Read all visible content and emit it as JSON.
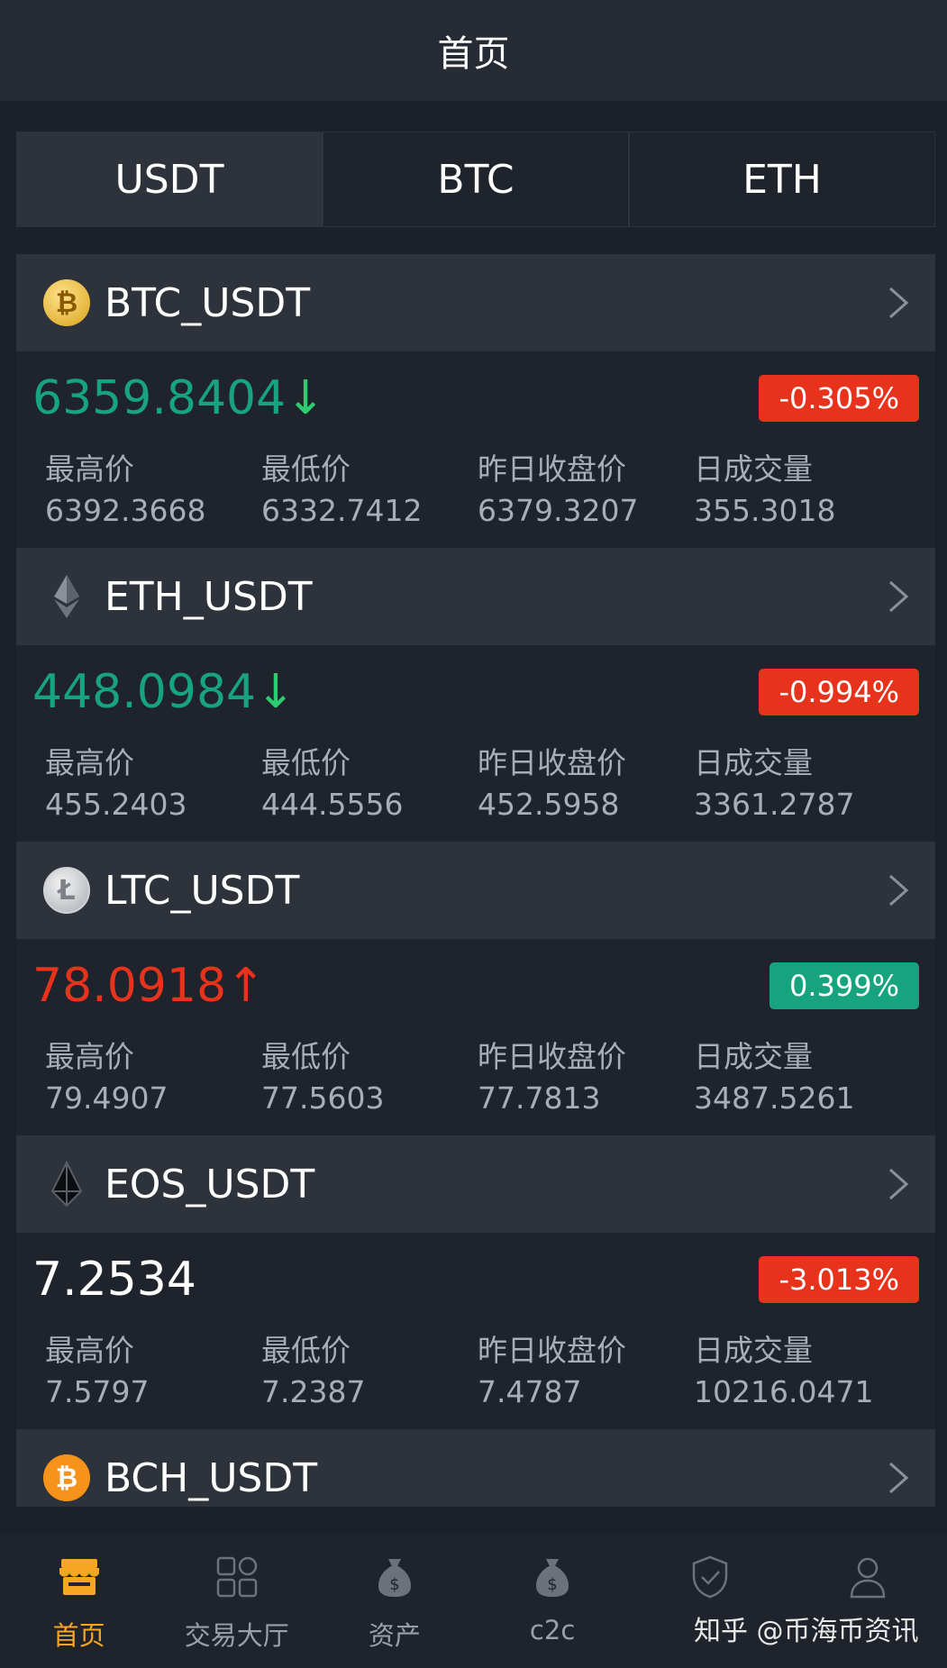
{
  "header": {
    "title": "首页"
  },
  "tabs": [
    {
      "label": "USDT",
      "active": true
    },
    {
      "label": "BTC",
      "active": false
    },
    {
      "label": "ETH",
      "active": false
    }
  ],
  "stat_labels": {
    "high": "最高价",
    "low": "最低价",
    "prev_close": "昨日收盘价",
    "volume": "日成交量"
  },
  "markets": [
    {
      "pair": "BTC_USDT",
      "icon": "bitcoin-icon",
      "price": "6359.8404",
      "direction": "down",
      "change": "-0.305%",
      "high": "6392.3668",
      "low": "6332.7412",
      "prev_close": "6379.3207",
      "volume": "355.3018"
    },
    {
      "pair": "ETH_USDT",
      "icon": "ethereum-icon",
      "price": "448.0984",
      "direction": "down",
      "change": "-0.994%",
      "high": "455.2403",
      "low": "444.5556",
      "prev_close": "452.5958",
      "volume": "3361.2787"
    },
    {
      "pair": "LTC_USDT",
      "icon": "litecoin-icon",
      "price": "78.0918",
      "direction": "up",
      "change": "0.399%",
      "high": "79.4907",
      "low": "77.5603",
      "prev_close": "77.7813",
      "volume": "3487.5261"
    },
    {
      "pair": "EOS_USDT",
      "icon": "eos-icon",
      "price": "7.2534",
      "direction": "flat",
      "change": "-3.013%",
      "high": "7.5797",
      "low": "7.2387",
      "prev_close": "7.4787",
      "volume": "10216.0471"
    },
    {
      "pair": "BCH_USDT",
      "icon": "bitcoin-cash-icon"
    }
  ],
  "nav": [
    {
      "label": "首页",
      "icon": "shop-icon",
      "active": true
    },
    {
      "label": "交易大厅",
      "icon": "grid-icon",
      "active": false
    },
    {
      "label": "资产",
      "icon": "money-bag-icon",
      "active": false
    },
    {
      "label": "c2c",
      "icon": "money-bag-icon",
      "active": false
    },
    {
      "label": "",
      "icon": "shield-icon",
      "active": false
    },
    {
      "label": "",
      "icon": "user-icon",
      "active": false
    }
  ],
  "watermark": "知乎 @币海币资讯",
  "colors": {
    "up": "#e8331c",
    "down": "#16a37d",
    "flat": "#ffffff",
    "accent": "#f5a623"
  }
}
